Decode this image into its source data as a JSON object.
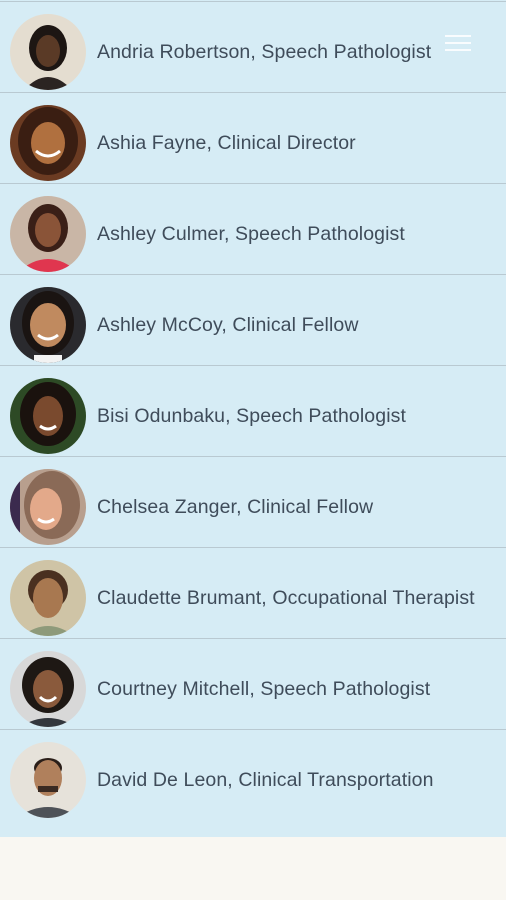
{
  "staff": [
    {
      "name": "Andria Robertson, Speech Pathologist"
    },
    {
      "name": "Ashia Fayne, Clinical Director"
    },
    {
      "name": "Ashley Culmer, Speech Pathologist"
    },
    {
      "name": "Ashley McCoy, Clinical Fellow"
    },
    {
      "name": "Bisi Odunbaku, Speech Pathologist"
    },
    {
      "name": "Chelsea Zanger, Clinical Fellow"
    },
    {
      "name": "Claudette Brumant, Occupational Therapist"
    },
    {
      "name": "Courtney Mitchell, Speech Pathologist"
    },
    {
      "name": "David De Leon, Clinical Transportation"
    }
  ],
  "menu": {
    "icon": "hamburger-menu-icon"
  },
  "colors": {
    "background": "#d6ecf5",
    "divider": "#b9c9d1",
    "text": "#3f4c5a",
    "footer": "#f9f7f2"
  }
}
